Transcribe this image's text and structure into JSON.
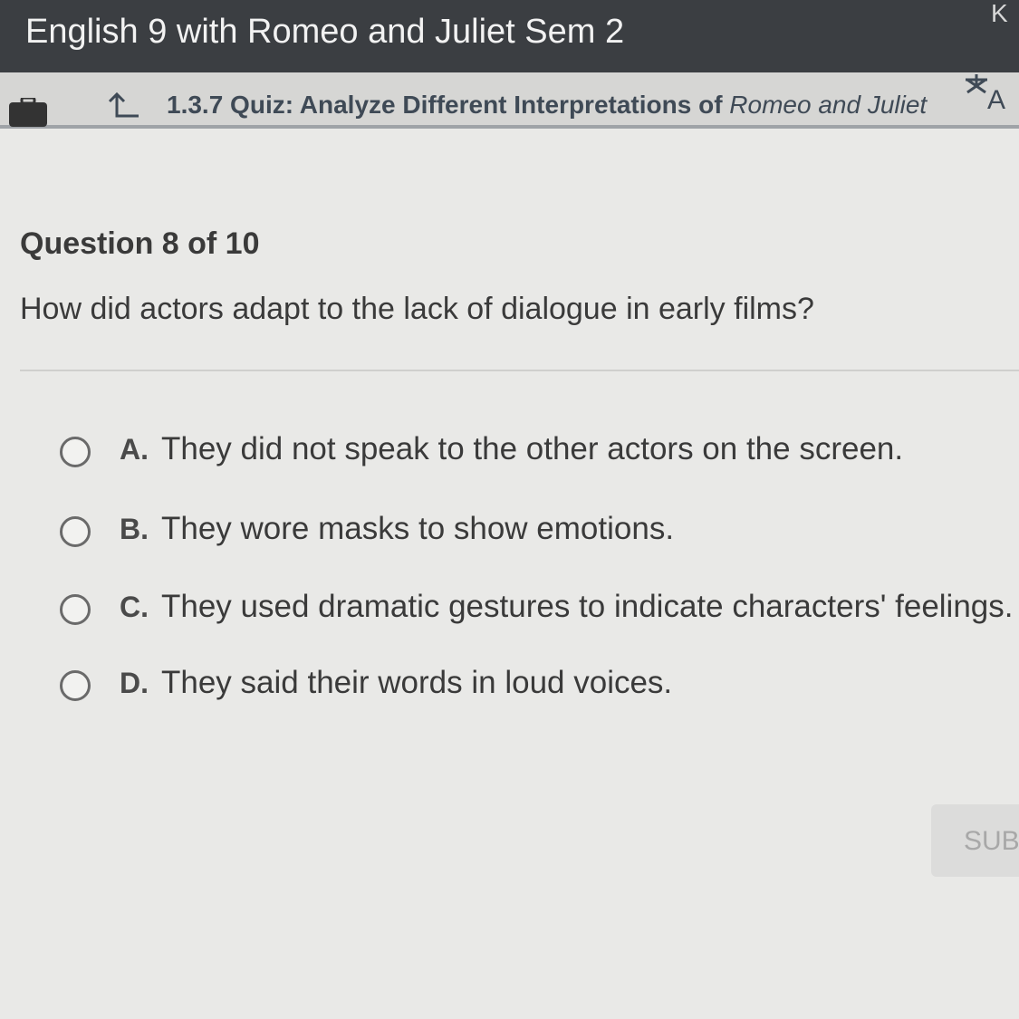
{
  "header": {
    "course_title": "English 9 with Romeo and Juliet Sem 2",
    "top_right_glyph": "K"
  },
  "subheader": {
    "quiz_prefix": "1.3.7 Quiz: Analyze Different Interpretations of ",
    "quiz_italic": "Romeo and Juliet",
    "tts_label": "A"
  },
  "question": {
    "counter": "Question 8 of 10",
    "text": "How did actors adapt to the lack of dialogue in early films?"
  },
  "options": [
    {
      "letter": "A.",
      "text": "They did not speak to the other actors on the screen."
    },
    {
      "letter": "B.",
      "text": "They wore masks to show emotions."
    },
    {
      "letter": "C.",
      "text": "They used dramatic gestures to indicate characters' feelings."
    },
    {
      "letter": "D.",
      "text": "They said their words in loud voices."
    }
  ],
  "submit": {
    "label": "SUBMIT"
  },
  "colors": {
    "topbar": "#3b3e42",
    "subbar": "#d6d6d4",
    "accent_text": "#3f4a56",
    "page_bg": "#e9e9e7"
  }
}
